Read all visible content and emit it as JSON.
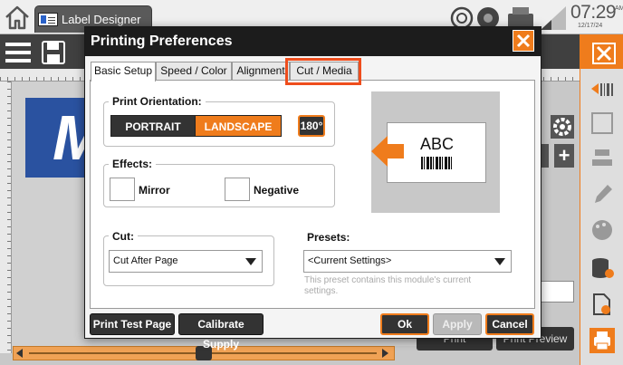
{
  "app": {
    "tab_label": "Label Designer",
    "clock_time": "07:29",
    "clock_ampm": "AM",
    "clock_date": "12/17/24",
    "canvas_char": "M",
    "bg_print_label": "Print",
    "bg_preview_label": "Print Preview"
  },
  "dialog": {
    "title": "Printing Preferences",
    "tabs": [
      {
        "label": "Basic Setup",
        "active": true
      },
      {
        "label": "Speed / Color",
        "active": false
      },
      {
        "label": "Alignment",
        "active": false
      },
      {
        "label": "Cut / Media",
        "active": false,
        "highlighted": true
      }
    ],
    "orientation": {
      "legend": "Print Orientation:",
      "portrait": "PORTRAIT",
      "landscape": "LANDSCAPE",
      "selected": "LANDSCAPE",
      "rotate": "180°"
    },
    "effects": {
      "legend": "Effects:",
      "mirror": "Mirror",
      "negative": "Negative",
      "mirror_checked": false,
      "negative_checked": false
    },
    "cut": {
      "legend": "Cut:",
      "value": "Cut After Page"
    },
    "presets": {
      "label": "Presets:",
      "value": "<Current Settings>",
      "help": "This preset contains this module's current settings."
    },
    "preview": {
      "label_text": "ABC"
    },
    "buttons": {
      "print_test": "Print Test Page",
      "calibrate": "Calibrate Supply",
      "ok": "Ok",
      "apply": "Apply",
      "cancel": "Cancel"
    }
  },
  "colors": {
    "accent": "#ef7c1c",
    "highlight": "#ef4d1c",
    "dark": "#1c1c1c",
    "canvas_blue": "#2a52a0"
  }
}
